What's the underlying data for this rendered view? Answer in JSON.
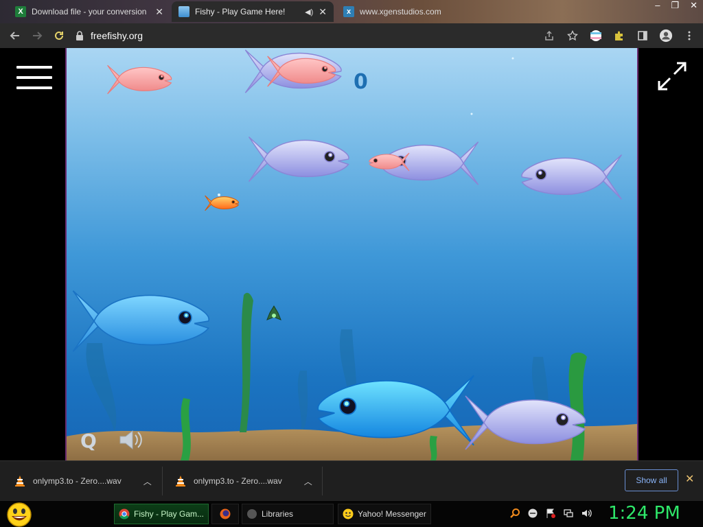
{
  "browser": {
    "tabs": [
      {
        "title": "Download file - your conversion",
        "icon": "excel-icon",
        "color": "#1e7d3a"
      },
      {
        "title": "Fishy - Play Game Here!",
        "icon": "fishy-favicon",
        "color": "#4a8fd6",
        "active": true
      },
      {
        "title": "www.xgenstudios.com",
        "icon": "xgen-icon",
        "color": "#2f7fb5"
      }
    ],
    "window_controls": [
      "–",
      "❐",
      "✕"
    ],
    "url": "freefishy.org"
  },
  "game": {
    "score": "0",
    "q_label": "Q"
  },
  "downloads": {
    "items": [
      {
        "name": "onlymp3.to - Zero....wav",
        "icon": "vlc-cone-icon"
      },
      {
        "name": "onlymp3.to - Zero....wav",
        "icon": "vlc-cone-icon"
      }
    ],
    "show_all_label": "Show all",
    "close_label": "✕"
  },
  "taskbar": {
    "buttons": [
      {
        "label": "Fishy - Play Gam...",
        "icon": "chrome-icon",
        "active": true
      },
      {
        "label": "",
        "icon": "firefox-icon"
      },
      {
        "label": "Libraries",
        "icon": "libraries-icon"
      },
      {
        "label": "Yahoo! Messenger",
        "icon": "yahoo-messenger-icon"
      }
    ],
    "clock": "1:24 PM"
  },
  "colors": {
    "accent_blue": "#8ab4f8",
    "clock_green": "#2ee86a",
    "water_top": "#aad6f3",
    "water_bottom": "#1766b5",
    "sand": "#a7865a"
  }
}
